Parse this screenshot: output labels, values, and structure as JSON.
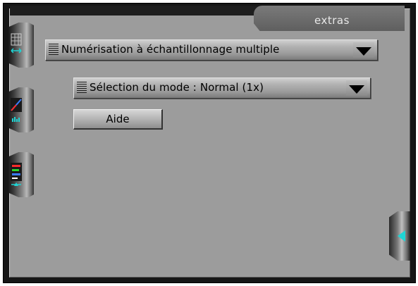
{
  "tab": {
    "label": "extras"
  },
  "main": {
    "multi_sample_dropdown": {
      "value": "Numérisation à échantillonnage multiple"
    },
    "mode_dropdown": {
      "value": "Sélection du mode : Normal (1x)"
    },
    "help_button": {
      "label": "Aide"
    }
  },
  "side_buttons": [
    {
      "icon": "scan-area-icon"
    },
    {
      "icon": "curve-histogram-icon"
    },
    {
      "icon": "color-levels-icon"
    }
  ],
  "right_button": {
    "icon": "collapse-left-arrow-icon",
    "accent": "#1fd4d4"
  },
  "colors": {
    "panel": "#9c9c9c",
    "frame": "#161616",
    "accent": "#1fd4d4"
  }
}
